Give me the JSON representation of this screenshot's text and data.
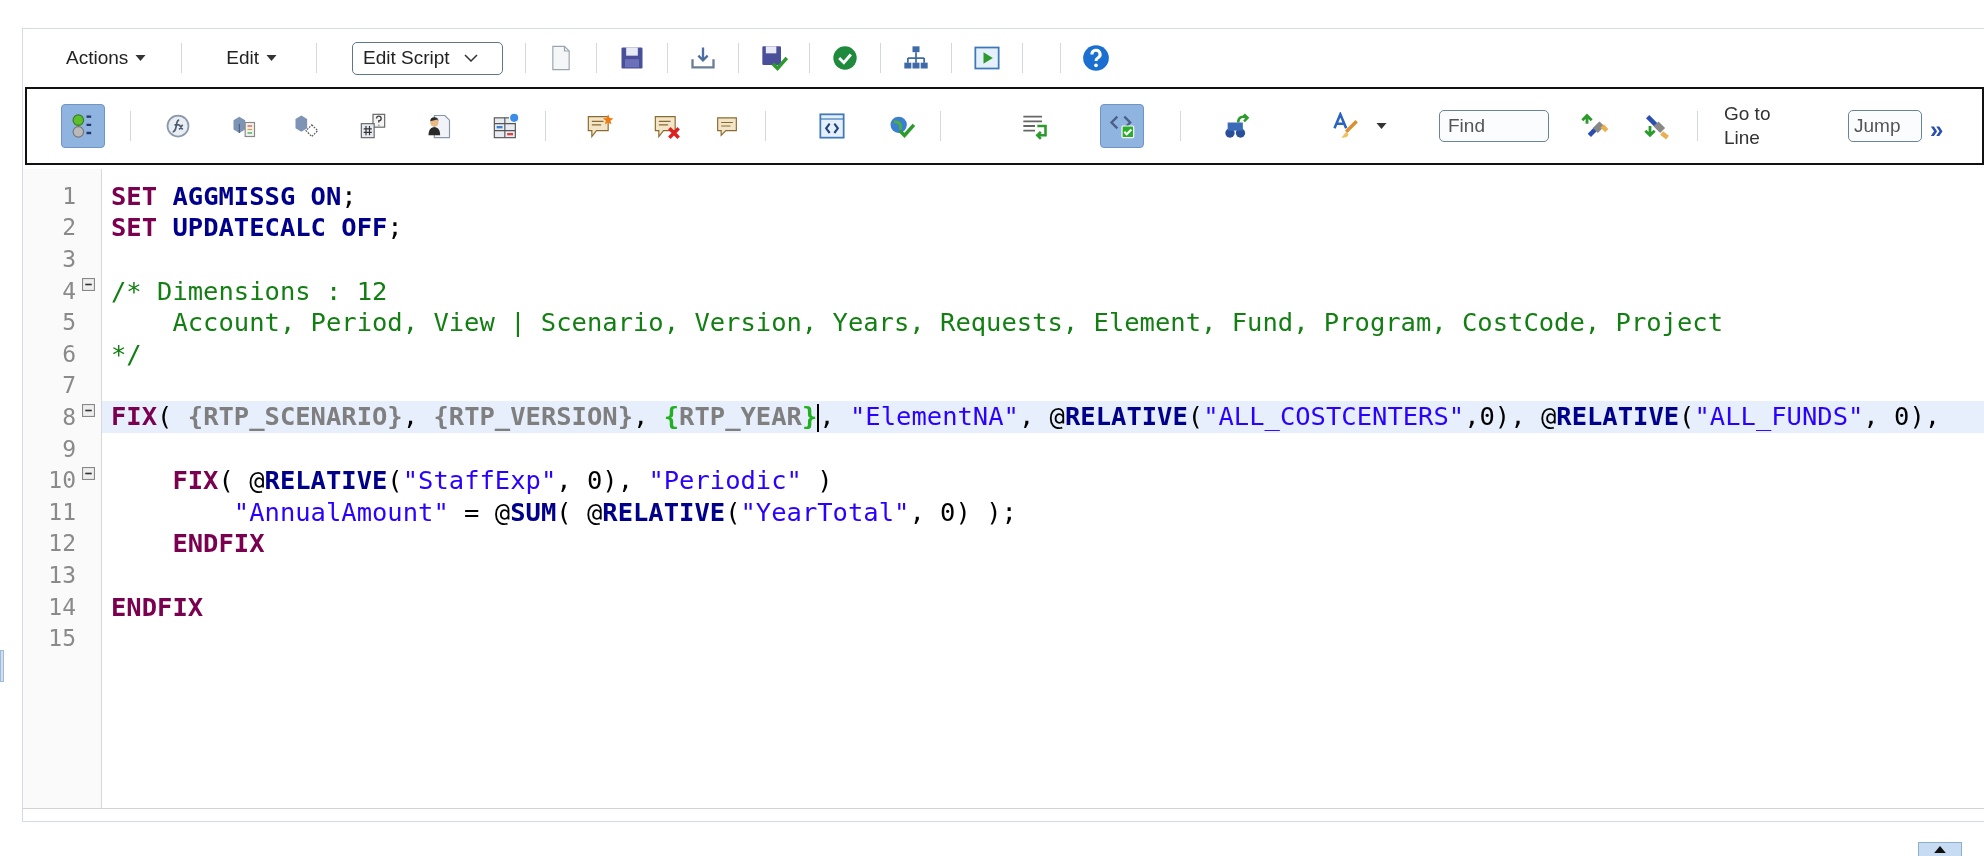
{
  "menu_bar": {
    "menus": [
      {
        "label": "Actions"
      },
      {
        "label": "Edit"
      }
    ],
    "mode_select": {
      "value": "Edit Script"
    }
  },
  "editor_toolbar": {
    "toggles": [
      {
        "on": true
      },
      {
        "on": true
      }
    ],
    "find_field": {
      "placeholder": "Find"
    },
    "goto_label": "Go to Line",
    "jump_field": {
      "placeholder": "Jump"
    },
    "overflow": "»"
  },
  "editor": {
    "lines": [
      {
        "number": "1",
        "fold": false,
        "selected": false,
        "tokens": [
          {
            "kind": "keyword",
            "text": "SET "
          },
          {
            "kind": "function",
            "text": "AGGMISSG ON"
          },
          {
            "kind": "text",
            "text": ";"
          }
        ]
      },
      {
        "number": "2",
        "fold": false,
        "selected": false,
        "tokens": [
          {
            "kind": "keyword",
            "text": "SET "
          },
          {
            "kind": "function",
            "text": "UPDATECALC OFF"
          },
          {
            "kind": "text",
            "text": ";"
          }
        ]
      },
      {
        "number": "3",
        "fold": false,
        "selected": false
      },
      {
        "number": "4",
        "fold": true,
        "selected": false,
        "tokens": [
          {
            "kind": "comment",
            "text": "/* Dimensions : 12"
          }
        ]
      },
      {
        "number": "5",
        "fold": false,
        "selected": false,
        "tokens": [
          {
            "kind": "comment",
            "text": "    Account, Period, View | Scenario, Version, Years, Requests, Element, Fund, Program, CostCode, Project"
          }
        ]
      },
      {
        "number": "6",
        "fold": false,
        "selected": false,
        "tokens": [
          {
            "kind": "comment",
            "text": "*/"
          }
        ]
      },
      {
        "number": "7",
        "fold": false,
        "selected": false
      },
      {
        "number": "8",
        "fold": true,
        "selected": true,
        "tokens": [
          {
            "kind": "keyword",
            "text": "FIX"
          },
          {
            "kind": "text",
            "text": "( "
          },
          {
            "kind": "variable",
            "text": "{RTP_SCENARIO}"
          },
          {
            "kind": "text",
            "text": ", "
          },
          {
            "kind": "variable",
            "text": "{RTP_VERSION}"
          },
          {
            "kind": "text",
            "text": ", "
          },
          {
            "kind": "brace",
            "text": "{"
          },
          {
            "kind": "variable",
            "text": "RTP_YEAR"
          },
          {
            "kind": "brace",
            "text": "}"
          },
          {
            "kind": "caret"
          },
          {
            "kind": "text",
            "text": ", "
          },
          {
            "kind": "string",
            "text": "\"ElementNA\""
          },
          {
            "kind": "text",
            "text": ", @"
          },
          {
            "kind": "function",
            "text": "RELATIVE"
          },
          {
            "kind": "text",
            "text": "("
          },
          {
            "kind": "string",
            "text": "\"ALL_COSTCENTERS\""
          },
          {
            "kind": "text",
            "text": ",0), @"
          },
          {
            "kind": "function",
            "text": "RELATIVE"
          },
          {
            "kind": "text",
            "text": "("
          },
          {
            "kind": "string",
            "text": "\"ALL_FUNDS\""
          },
          {
            "kind": "text",
            "text": ", 0),"
          }
        ]
      },
      {
        "number": "9",
        "fold": false,
        "selected": false
      },
      {
        "number": "10",
        "fold": true,
        "selected": false,
        "tokens": [
          {
            "kind": "keyword",
            "text": "    FIX"
          },
          {
            "kind": "text",
            "text": "( @"
          },
          {
            "kind": "function",
            "text": "RELATIVE"
          },
          {
            "kind": "text",
            "text": "("
          },
          {
            "kind": "string",
            "text": "\"StaffExp\""
          },
          {
            "kind": "text",
            "text": ", 0), "
          },
          {
            "kind": "string",
            "text": "\"Periodic\""
          },
          {
            "kind": "text",
            "text": " )"
          }
        ]
      },
      {
        "number": "11",
        "fold": false,
        "selected": false,
        "tokens": [
          {
            "kind": "string",
            "text": "        \"AnnualAmount\""
          },
          {
            "kind": "text",
            "text": " = @"
          },
          {
            "kind": "function",
            "text": "SUM"
          },
          {
            "kind": "text",
            "text": "( @"
          },
          {
            "kind": "function",
            "text": "RELATIVE"
          },
          {
            "kind": "text",
            "text": "("
          },
          {
            "kind": "string",
            "text": "\"YearTotal\""
          },
          {
            "kind": "text",
            "text": ", 0) );"
          }
        ]
      },
      {
        "number": "12",
        "fold": false,
        "selected": false,
        "tokens": [
          {
            "kind": "keyword",
            "text": "    ENDFIX"
          }
        ]
      },
      {
        "number": "13",
        "fold": false,
        "selected": false
      },
      {
        "number": "14",
        "fold": false,
        "selected": false,
        "tokens": [
          {
            "kind": "keyword",
            "text": "ENDFIX"
          }
        ]
      },
      {
        "number": "15",
        "fold": false,
        "selected": false
      }
    ]
  }
}
